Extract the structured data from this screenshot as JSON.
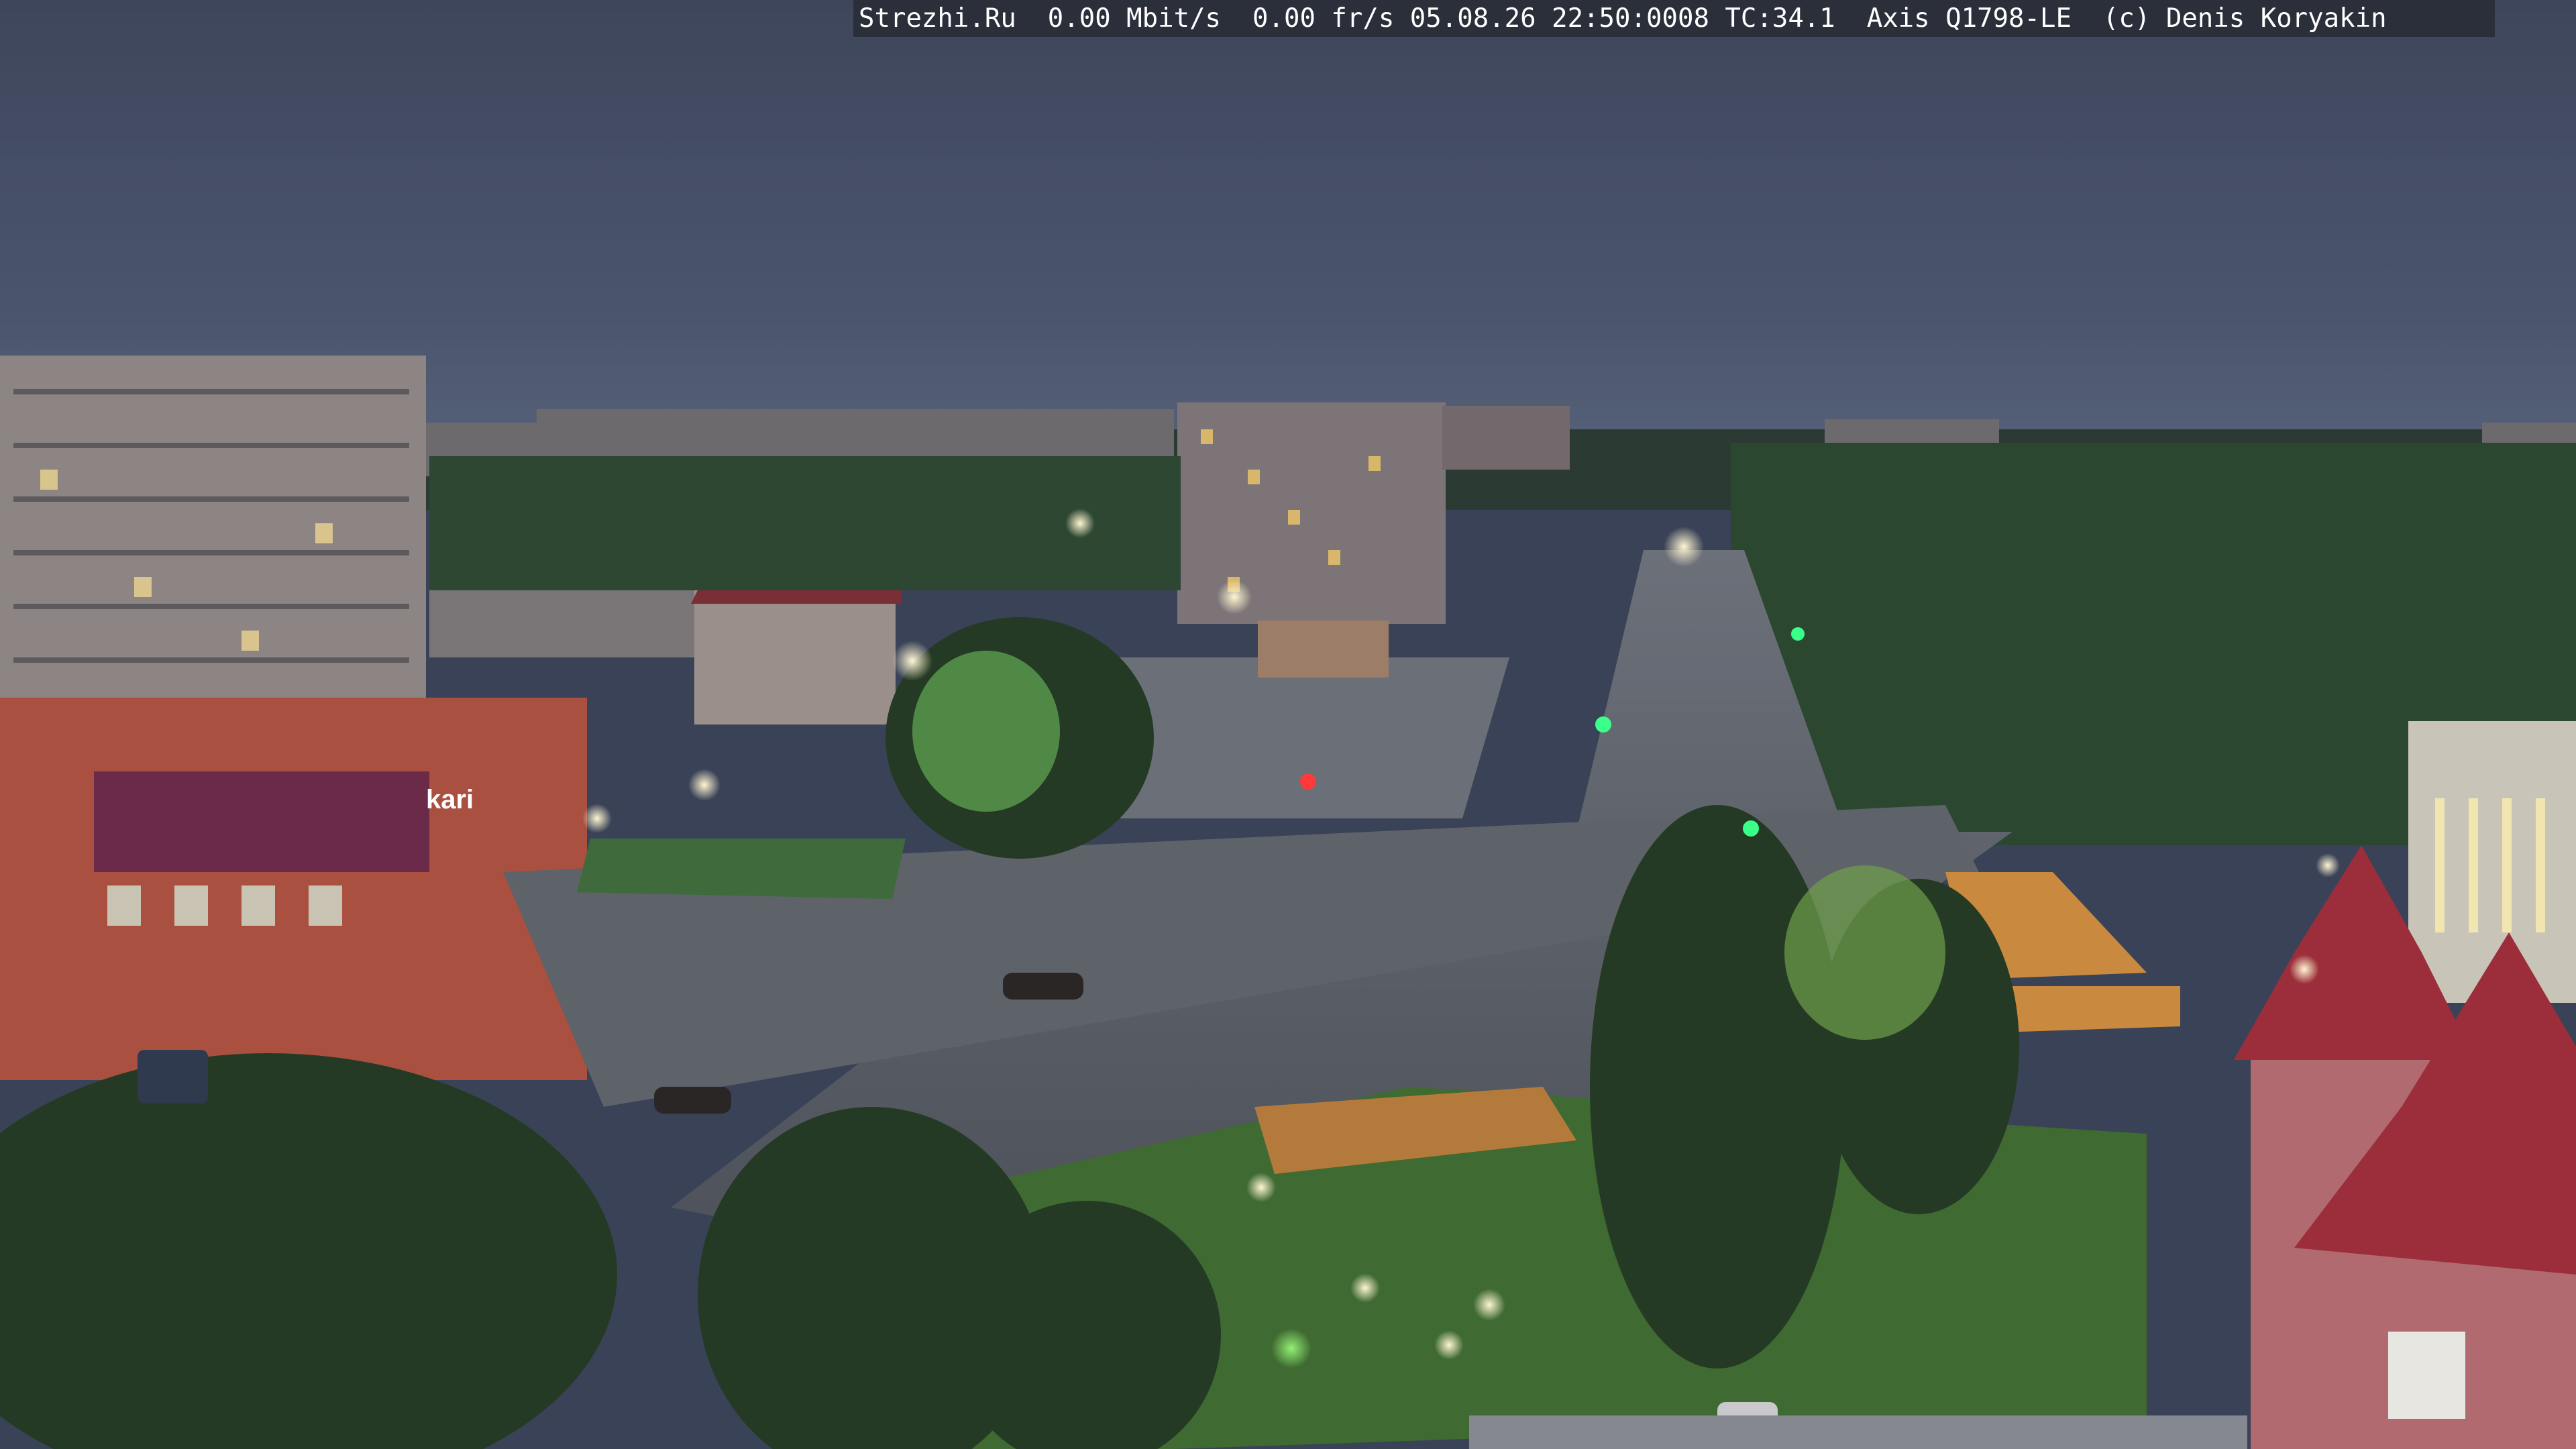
{
  "camera_overlay": {
    "text": "Strezhi.Ru  0.00 Mbit/s  0.00 fr/s 05.08.26 22:50:0008 TC:34.1  Axis Q1798-LE  (c) Denis Koryakin"
  },
  "scene": {
    "store_sign": "kari",
    "colors": {
      "sky_top": "#3f475d",
      "sky_horizon": "#4f5a72",
      "trees": "#2f4a2f",
      "road": "#5b6068",
      "building_brick": "#b4553f",
      "roof_red": "#9e2e3a"
    }
  }
}
